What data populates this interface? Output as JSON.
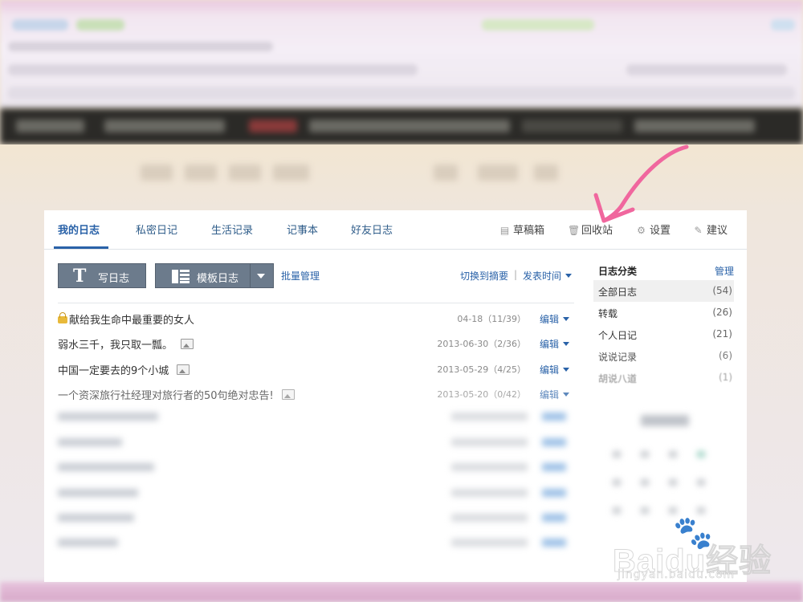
{
  "tabs": [
    {
      "label": "我的日志"
    },
    {
      "label": "私密日记"
    },
    {
      "label": "生活记录"
    },
    {
      "label": "记事本"
    },
    {
      "label": "好友日志"
    }
  ],
  "tools": {
    "drafts": "草稿箱",
    "recycle": "回收站",
    "settings": "设置",
    "suggest": "建议"
  },
  "toolbar": {
    "write_label": "写日志",
    "template_label": "模板日志",
    "batch_label": "批量管理",
    "switch_label": "切换到摘要",
    "separator": "|",
    "sort_label": "发表时间"
  },
  "entries": [
    {
      "title": "献给我生命中最重要的女人",
      "meta": "04-18（11/39）",
      "edit": "编辑"
    },
    {
      "title": "弱水三千，我只取一瓢。",
      "meta": "2013-06-30（2/36）",
      "edit": "编辑"
    },
    {
      "title": "中国一定要去的9个小城",
      "meta": "2013-05-29（4/25）",
      "edit": "编辑"
    },
    {
      "title": "一个资深旅行社经理对旅行者的50句绝对忠告!",
      "meta": "2013-05-20（0/42）",
      "edit": "编辑"
    }
  ],
  "sidebar": {
    "heading": "日志分类",
    "manage": "管理",
    "categories": [
      {
        "name": "全部日志",
        "count": "(54)"
      },
      {
        "name": "转载",
        "count": "(26)"
      },
      {
        "name": "个人日记",
        "count": "(21)"
      },
      {
        "name": "说说记录",
        "count": "(6)"
      },
      {
        "name": "胡说八道",
        "count": "(1)"
      }
    ]
  },
  "watermark": {
    "brand": "Baidu经验",
    "url": "jingyan.baidu.com"
  },
  "colors": {
    "accent": "#2a62a8",
    "button": "#6c7b8c",
    "annotation": "#f0679e"
  }
}
